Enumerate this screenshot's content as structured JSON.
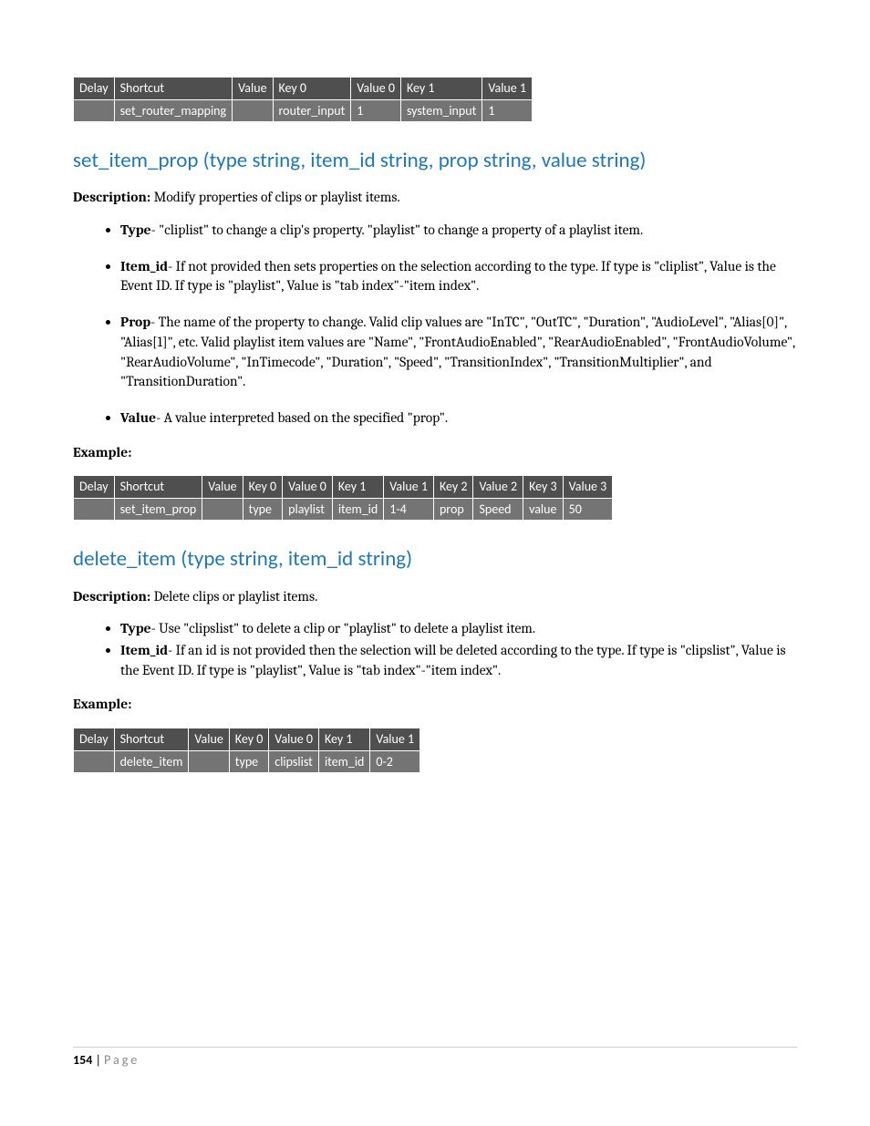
{
  "table1": {
    "head": [
      "Delay",
      "Shortcut",
      "Value",
      "Key 0",
      "Value 0",
      "Key 1",
      "Value 1"
    ],
    "row": [
      "",
      "set_router_mapping",
      "",
      "router_input",
      "1",
      "system_input",
      "1"
    ]
  },
  "sec1": {
    "heading": "set_item_prop (type string, item_id string, prop string, value string)",
    "desc_label": "Description:",
    "desc_text": " Modify properties of clips or playlist items.",
    "bullets": [
      {
        "k": "Type",
        "t": "- \"cliplist\" to change a clip's property.  \"playlist\" to change a property of a playlist item."
      },
      {
        "k": "Item_id",
        "t": "- If not provided then sets properties on the selection according to the type.  If type is \"cliplist\", Value is the Event ID.  If type is \"playlist\", Value is \"tab index\"-\"item index\"."
      },
      {
        "k": "Prop",
        "t": "- The name of the property to change.  Valid clip values are \"InTC\", \"OutTC\", \"Duration\", \"AudioLevel\", \"Alias[0]\", \"Alias[1]\", etc. Valid playlist item values are \"Name\", \"FrontAudioEnabled\", \"RearAudioEnabled\", \"FrontAudioVolume\", \"RearAudioVolume\", \"InTimecode\", \"Duration\", \"Speed\", \"TransitionIndex\", \"TransitionMultiplier\", and \"TransitionDuration\"."
      },
      {
        "k": "Value",
        "t": "- A value interpreted based on the specified \"prop\"."
      }
    ],
    "ex_label": "Example:"
  },
  "table2": {
    "head": [
      "Delay",
      "Shortcut",
      "Value",
      "Key 0",
      "Value 0",
      "Key 1",
      "Value 1",
      "Key 2",
      "Value 2",
      "Key 3",
      "Value 3"
    ],
    "row": [
      "",
      "set_item_prop",
      "",
      "type",
      "playlist",
      "item_id",
      "1-4",
      "prop",
      "Speed",
      "value",
      "50"
    ]
  },
  "sec2": {
    "heading": "delete_item (type string, item_id string)",
    "desc_label": "Description:",
    "desc_text": " Delete clips or playlist items.",
    "bullets": [
      {
        "k": "Type",
        "t": "- Use \"clipslist\" to delete a clip or  \"playlist\" to delete a playlist item."
      },
      {
        "k": "Item_id",
        "t": "- If an id is not provided then the selection will be deleted according to the type.  If type is \"clipslist\", Value is the Event ID.  If type is \"playlist\", Value is \"tab index\"-\"item index\"."
      }
    ],
    "ex_label": "Example:"
  },
  "table3": {
    "head": [
      "Delay",
      "Shortcut",
      "Value",
      "Key 0",
      "Value 0",
      "Key 1",
      "Value 1"
    ],
    "row": [
      "",
      "delete_item",
      "",
      "type",
      "clipslist",
      "item_id",
      "0-2"
    ]
  },
  "footer": {
    "num": "154",
    "sep": " | ",
    "word": "Page"
  }
}
